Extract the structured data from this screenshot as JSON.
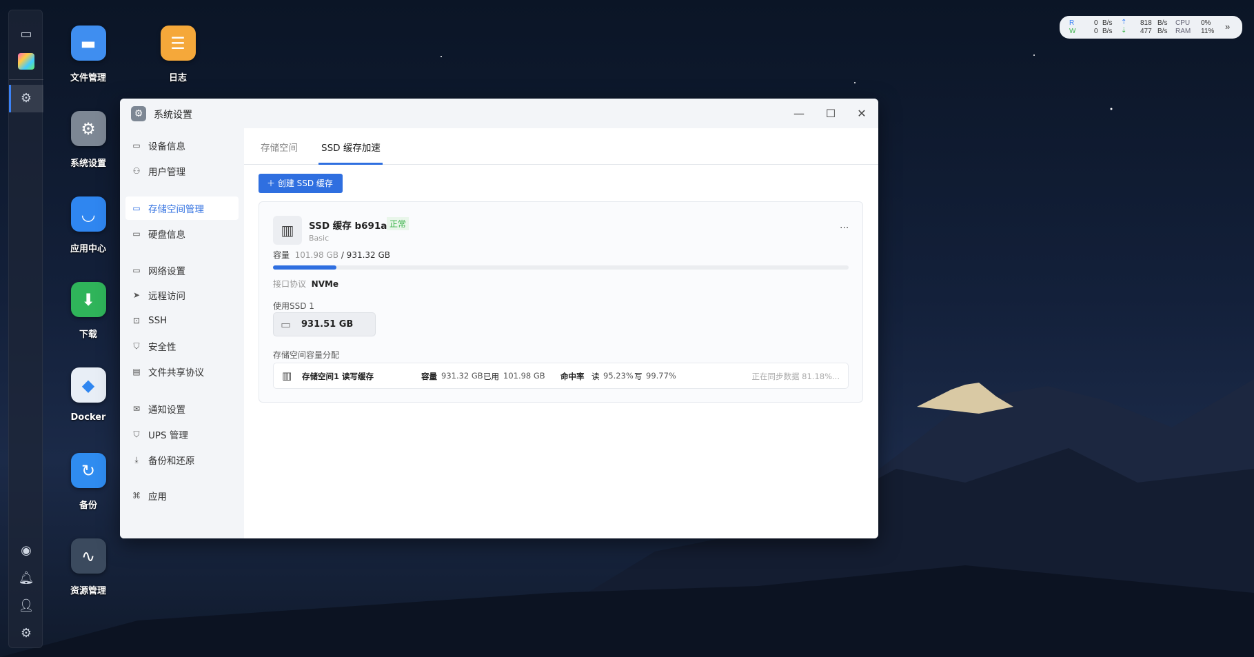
{
  "dock": {
    "icons": [
      "monitor-icon",
      "apps-icon",
      "settings-icon",
      "nav-icon",
      "bell-icon",
      "user-icon",
      "gear-icon"
    ]
  },
  "desktop": {
    "icons": [
      {
        "label": "文件管理",
        "icon": "folder-icon",
        "color": "#3f8ef0"
      },
      {
        "label": "日志",
        "icon": "log-icon",
        "color": "#f5a83a"
      },
      {
        "label": "系统设置",
        "icon": "gear-icon",
        "color": "#7d8794"
      },
      {
        "label": "应用中心",
        "icon": "store-icon",
        "color": "#2f86f0"
      },
      {
        "label": "下载",
        "icon": "download-icon",
        "color": "#2fb45a"
      },
      {
        "label": "Docker",
        "icon": "docker-icon",
        "color": "#e8eef6"
      },
      {
        "label": "备份",
        "icon": "backup-icon",
        "color": "#2f8cf0"
      },
      {
        "label": "资源管理",
        "icon": "monitor-chart-icon",
        "color": "#3b4a5e"
      }
    ]
  },
  "widget": {
    "r": "R",
    "w": "W",
    "read": "0",
    "write": "0",
    "unit": "B/s",
    "up": "818",
    "down": "477",
    "cpu_label": "CPU",
    "ram_label": "RAM",
    "cpu": "0%",
    "ram": "11%"
  },
  "window": {
    "title": "系统设置",
    "sidebar": [
      "设备信息",
      "用户管理",
      "存储空间管理",
      "硬盘信息",
      "网络设置",
      "远程访问",
      "SSH",
      "安全性",
      "文件共享协议",
      "通知设置",
      "UPS 管理",
      "备份和还原",
      "应用"
    ],
    "active_sidebar": "存储空间管理",
    "tabs": [
      "存储空间",
      "SSD 缓存加速"
    ],
    "active_tab": "SSD 缓存加速",
    "create_button": "创建 SSD 缓存",
    "cache": {
      "name": "SSD 缓存 b691a",
      "status": "正常",
      "type": "Basic",
      "capacity_label": "容量",
      "used": "101.98 GB",
      "total": "/ 931.32 GB",
      "used_fraction": 0.11,
      "protocol_label": "接口协议",
      "protocol": "NVMe",
      "ssd_label": "使用SSD 1",
      "ssd_size": "931.51 GB",
      "alloc_label": "存储空间容量分配",
      "alloc": {
        "name": "存储空间1 读写缓存",
        "cap_label": "容量",
        "cap": "931.32 GB",
        "used_label": "已用",
        "used": "101.98 GB",
        "hit_label": "命中率",
        "read_label": "读",
        "read": "95.23%",
        "write_label": "写",
        "write": "99.77%",
        "sync": "正在同步数据 81.18%..."
      }
    }
  }
}
